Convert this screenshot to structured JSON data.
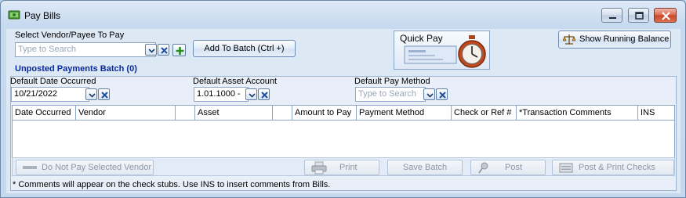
{
  "window": {
    "title": "Pay Bills",
    "controls": [
      "minimize-icon",
      "maximize-icon",
      "close-icon"
    ],
    "accent_color": "#0a2a9a"
  },
  "vendor": {
    "label": "Select Vendor/Payee To Pay",
    "placeholder": "Type to Search",
    "add_to_batch_label": "Add To Batch (Ctrl +)"
  },
  "quick_pay": {
    "label": "Quick Pay"
  },
  "running_balance": {
    "label": "Show Running Balance"
  },
  "batch": {
    "title": "Unposted Payments Batch (0)"
  },
  "defaults": {
    "date_label": "Default Date Occurred",
    "date_value": "10/21/2022",
    "asset_label": "Default Asset Account",
    "asset_value": "1.01.1000 -",
    "method_label": "Default Pay Method",
    "method_placeholder": "Type to Search"
  },
  "table": {
    "columns": [
      "Date Occurred",
      "Vendor",
      "",
      "Asset",
      "",
      "Amount to Pay",
      "Payment Method",
      "Check or Ref #",
      "*Transaction Comments",
      "INS"
    ],
    "rows": []
  },
  "actions": {
    "do_not_pay": "Do Not Pay Selected Vendor",
    "print": "Print",
    "save_batch": "Save Batch",
    "post": "Post",
    "post_print": "Post & Print Checks"
  },
  "footer": {
    "note": "* Comments will appear on the check stubs. Use INS to insert comments from Bills."
  }
}
